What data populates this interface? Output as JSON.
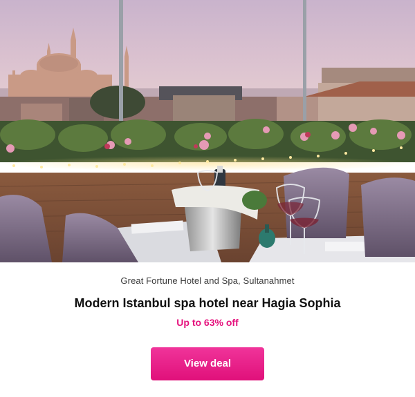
{
  "deal": {
    "image_alt": "Rooftop terrace restaurant overlooking Hagia Sophia at dusk",
    "hotel_name": "Great Fortune Hotel and Spa, Sultanahmet",
    "headline": "Modern Istanbul spa hotel near Hagia Sophia",
    "discount": "Up to 63% off",
    "cta_label": "View deal"
  },
  "colors": {
    "accent": "#e5127d",
    "cta_gradient_start": "#f0349a",
    "cta_gradient_end": "#e0107a",
    "text_dark": "#111111",
    "text_muted": "#3a3a3a"
  }
}
